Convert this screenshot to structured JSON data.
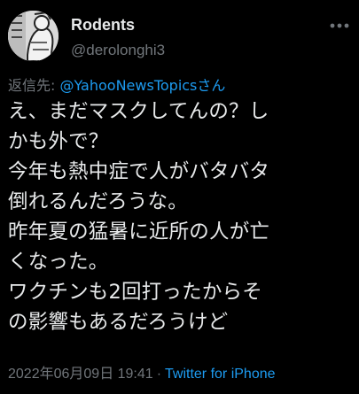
{
  "author": {
    "display_name": "Rodents",
    "handle": "@derolonghi3"
  },
  "reply": {
    "prefix": "返信先: ",
    "mention": "@YahooNewsTopics",
    "suffix": "さん"
  },
  "tweet": {
    "lines": [
      "え、まだマスクしてんの？し",
      "かも外で？",
      "今年も熱中症で人がバタバタ",
      "倒れるんだろうな。",
      "昨年夏の猛暑に近所の人が亡",
      "くなった。",
      "ワクチンも2回打ったからそ",
      "の影響もあるだろうけど"
    ]
  },
  "meta": {
    "timestamp": "2022年06月09日 19:41",
    "separator": "·",
    "source": "Twitter for iPhone"
  },
  "icons": {
    "avatar": "avatar-image",
    "more": "more-options-icon"
  },
  "colors": {
    "background": "#000000",
    "text_primary": "#e7e9ea",
    "text_secondary": "#71767b",
    "link": "#1d9bf0"
  }
}
